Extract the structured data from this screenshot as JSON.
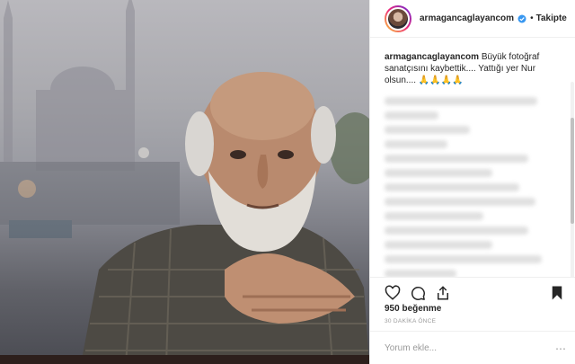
{
  "post": {
    "username": "armagancaglayancom",
    "follow_label": "Takipte",
    "separator": "•"
  },
  "caption": {
    "username": "armagancaglayancom",
    "text": "Büyük fotoğraf sanatçısını kaybettik.... Yattığı yer Nur olsun.... 🙏🙏🙏🙏"
  },
  "engagement": {
    "likes_label": "950 beğenme",
    "time_label": "30 DAKİKA ÖNCE"
  },
  "comment_box": {
    "placeholder": "Yorum ekle..."
  },
  "colors": {
    "accent": "#262626",
    "muted": "#999999",
    "border": "#efefef"
  },
  "icons": [
    "verified-icon",
    "heart-icon",
    "comment-icon",
    "share-icon",
    "bookmark-icon",
    "more-options-icon"
  ]
}
